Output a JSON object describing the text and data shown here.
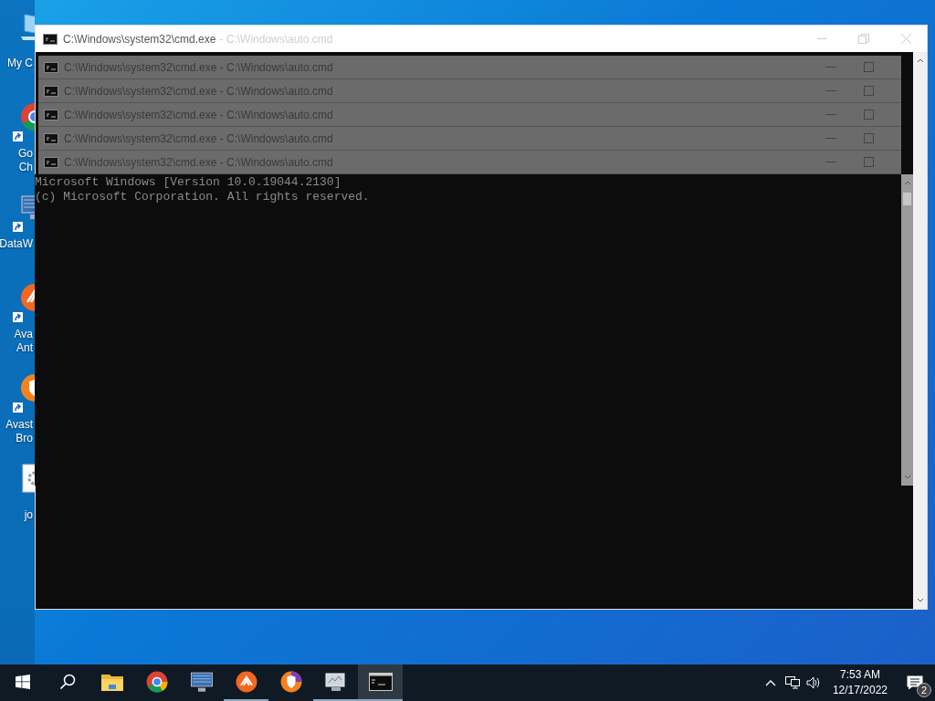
{
  "desktop_icons": [
    {
      "kind": "computer",
      "label_lines": [
        "My C"
      ]
    },
    {
      "kind": "chrome",
      "label_lines": [
        "Go",
        "Ch"
      ]
    },
    {
      "kind": "grid",
      "label_lines": [
        "DataW"
      ]
    },
    {
      "kind": "avast",
      "label_lines": [
        "Ava",
        "Ant"
      ]
    },
    {
      "kind": "avast_browser",
      "label_lines": [
        "Avast",
        "Bro"
      ]
    },
    {
      "kind": "file",
      "label_lines": [
        "jo"
      ]
    }
  ],
  "back_window": {
    "title": "C:\\Windows\\system32\\cmd.exe",
    "ghost_title": "- C:\\Windows\\auto.cmd"
  },
  "stacked_windows": [
    {
      "title": "C:\\Windows\\system32\\cmd.exe - C:\\Windows\\auto.cmd"
    },
    {
      "title": "C:\\Windows\\system32\\cmd.exe - C:\\Windows\\auto.cmd"
    },
    {
      "title": "C:\\Windows\\system32\\cmd.exe - C:\\Windows\\auto.cmd"
    },
    {
      "title": "C:\\Windows\\system32\\cmd.exe - C:\\Windows\\auto.cmd"
    },
    {
      "title": "C:\\Windows\\system32\\cmd.exe - C:\\Windows\\auto.cmd"
    }
  ],
  "console": {
    "lines": [
      "Microsoft Windows [Version 10.0.19044.2130]",
      "(c) Microsoft Corporation. All rights reserved."
    ]
  },
  "taskbar": {
    "items": [
      {
        "kind": "start",
        "running": false,
        "active": false
      },
      {
        "kind": "search",
        "running": false,
        "active": false
      },
      {
        "kind": "explorer",
        "running": false,
        "active": false
      },
      {
        "kind": "chrome",
        "running": false,
        "active": false
      },
      {
        "kind": "computer",
        "running": false,
        "active": false
      },
      {
        "kind": "avast",
        "running": true,
        "active": false
      },
      {
        "kind": "avast_browser",
        "running": false,
        "active": false
      },
      {
        "kind": "app",
        "running": true,
        "active": false
      },
      {
        "kind": "console",
        "running": true,
        "active": true
      }
    ]
  },
  "tray": {
    "time": "7:53 AM",
    "date": "12/17/2022",
    "notification_count": "2"
  }
}
